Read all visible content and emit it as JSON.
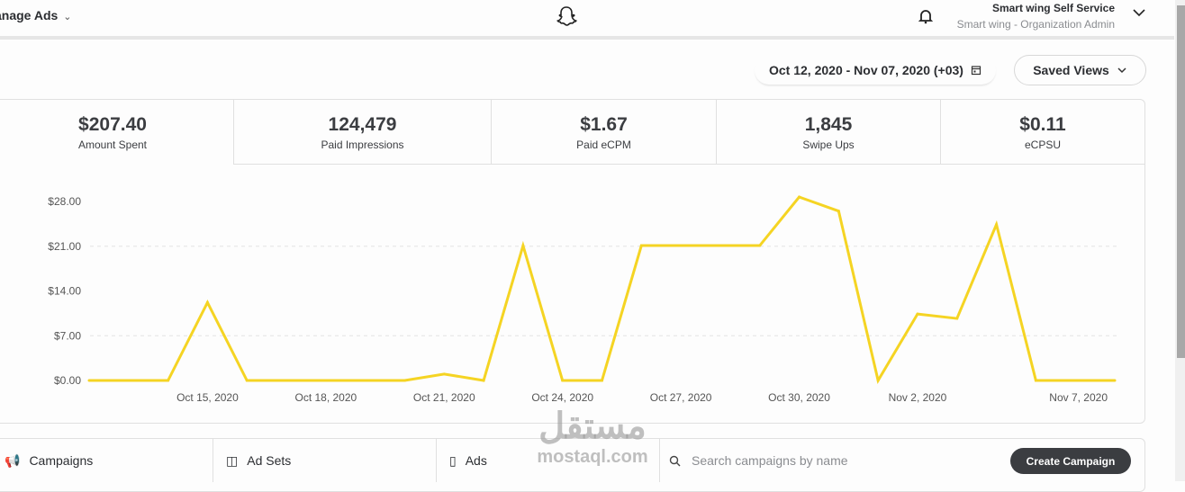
{
  "header": {
    "app_name": "anage Ads",
    "account_name": "Smart wing Self Service",
    "account_role": "Smart wing - Organization Admin",
    "icons": [
      "chevron-down-icon",
      "snapchat-ghost-icon",
      "bell-icon"
    ]
  },
  "toolbar": {
    "date_range": "Oct 12, 2020 - Nov 07, 2020 (+03)",
    "saved_views": "Saved Views"
  },
  "metrics": [
    {
      "value": "$207.40",
      "label": "Amount Spent",
      "active": true
    },
    {
      "value": "124,479",
      "label": "Paid Impressions"
    },
    {
      "value": "$1.67",
      "label": "Paid eCPM"
    },
    {
      "value": "1,845",
      "label": "Swipe Ups"
    },
    {
      "value": "$0.11",
      "label": "eCPSU"
    }
  ],
  "chart_data": {
    "type": "line",
    "color": "#f5d423",
    "x": [
      "Oct 12",
      "Oct 13",
      "Oct 14",
      "Oct 15",
      "Oct 16",
      "Oct 17",
      "Oct 18",
      "Oct 19",
      "Oct 20",
      "Oct 21",
      "Oct 22",
      "Oct 23",
      "Oct 24",
      "Oct 25",
      "Oct 26",
      "Oct 27",
      "Oct 28",
      "Oct 29",
      "Oct 30",
      "Oct 31",
      "Nov 1",
      "Nov 2",
      "Nov 3",
      "Nov 4",
      "Nov 5",
      "Nov 6",
      "Nov 7"
    ],
    "values": [
      0,
      0,
      0,
      12.2,
      0,
      0,
      0,
      0,
      0,
      1.0,
      0,
      21.1,
      0,
      0,
      21.1,
      21.1,
      21.1,
      21.1,
      28.7,
      26.5,
      0,
      10.4,
      9.7,
      24.4,
      0,
      0,
      0
    ],
    "ylim": [
      0,
      28
    ],
    "y_ticks": [
      "$0.00",
      "$7.00",
      "$14.00",
      "$21.00",
      "$28.00"
    ],
    "x_tick_labels": [
      {
        "i": 3,
        "label": "Oct 15, 2020"
      },
      {
        "i": 6,
        "label": "Oct 18, 2020"
      },
      {
        "i": 9,
        "label": "Oct 21, 2020"
      },
      {
        "i": 12,
        "label": "Oct 24, 2020"
      },
      {
        "i": 15,
        "label": "Oct 27, 2020"
      },
      {
        "i": 18,
        "label": "Oct 30, 2020"
      },
      {
        "i": 21,
        "label": "Nov 2, 2020"
      },
      {
        "i": 26,
        "label": "Nov 7, 2020"
      }
    ],
    "grid": "dashed at $7.00 and $21.00"
  },
  "tabs": [
    {
      "label": "Campaigns",
      "icon": "megaphone-icon"
    },
    {
      "label": "Ad Sets",
      "icon": "ad-set-icon"
    },
    {
      "label": "Ads",
      "icon": "phone-icon"
    }
  ],
  "search": {
    "placeholder": "Search campaigns by name"
  },
  "create_button": "Create Campaign",
  "watermark": {
    "arabic": "مستقل",
    "latin": "mostaql.com"
  }
}
